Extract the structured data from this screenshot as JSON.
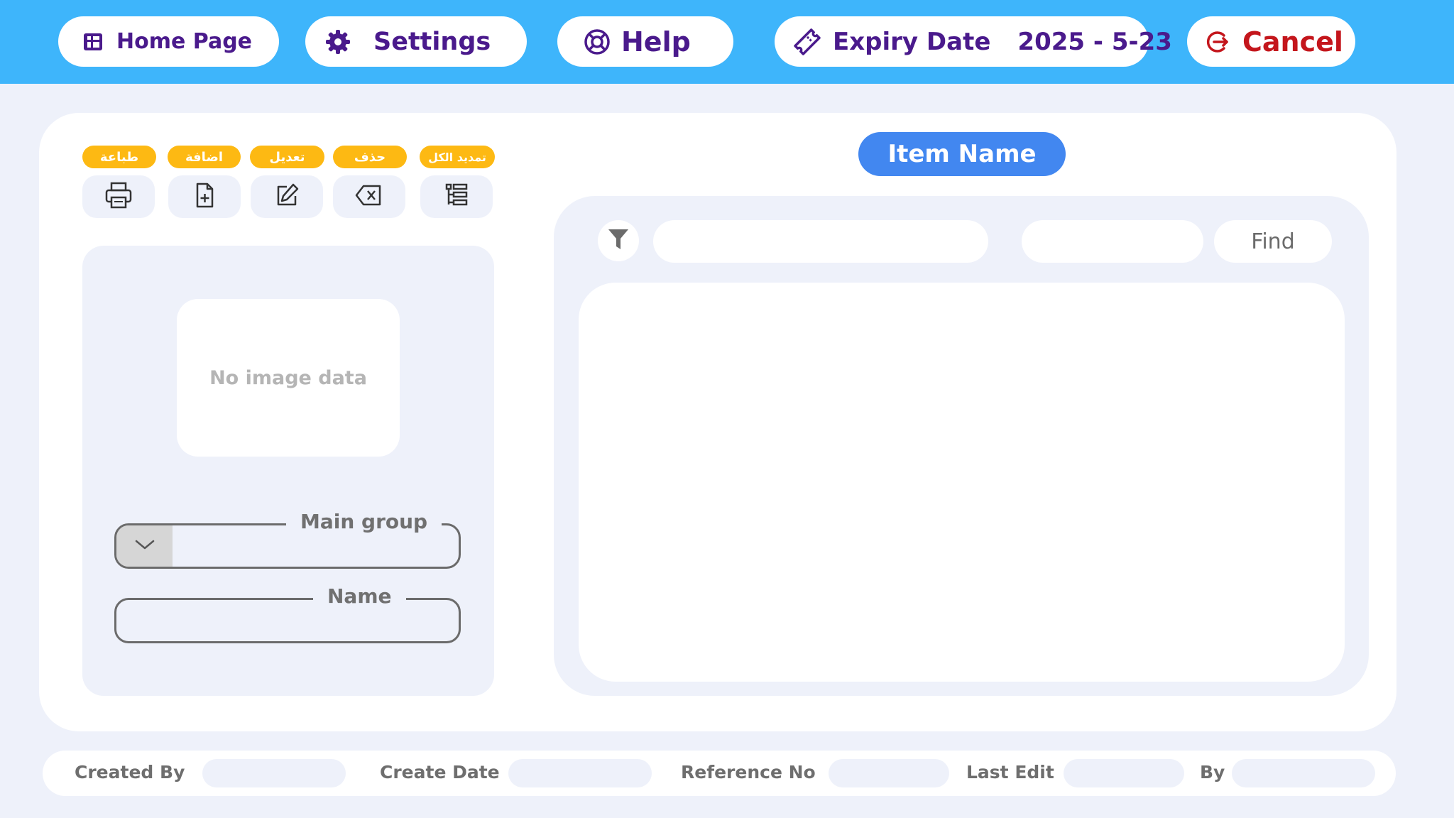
{
  "topbar": {
    "home_label": "Home Page",
    "settings_label": "Settings",
    "help_label": "Help",
    "expiry_label": "Expiry Date",
    "expiry_value": "2025 - 5-23",
    "cancel_label": "Cancel"
  },
  "toolbar": {
    "print_label": "طباعة",
    "add_label": "اضافة",
    "edit_label": "تعديل",
    "delete_label": "حذف",
    "select_all_label": "تمديد الكل"
  },
  "left_panel": {
    "image_placeholder": "No image data",
    "main_group_label": "Main group",
    "main_group_value": "",
    "name_label": "Name",
    "name_value": ""
  },
  "right_panel": {
    "title": "Item Name",
    "search_value": "",
    "search_secondary_value": "",
    "find_label": "Find"
  },
  "footer": {
    "created_by_label": "Created By",
    "create_date_label": "Create Date",
    "reference_no_label": "Reference No",
    "last_edit_label": "Last Edit",
    "by_label": "By"
  },
  "colors": {
    "topbar": "#3eb5fb",
    "background": "#eef1fa",
    "accent_purple": "#4a1a8c",
    "cancel_red": "#c4161c",
    "label_yellow": "#fdb913",
    "primary_blue": "#4287f0"
  }
}
